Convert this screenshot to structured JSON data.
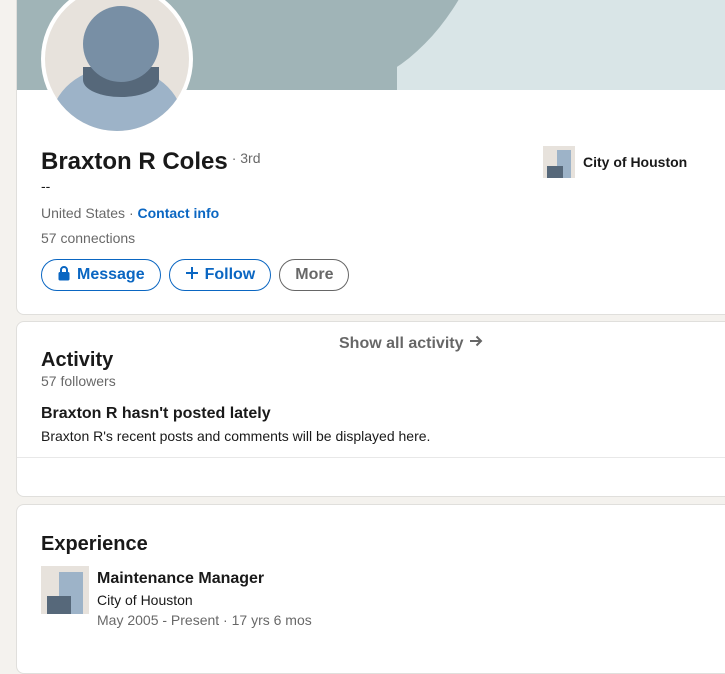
{
  "profile": {
    "name": "Braxton R Coles",
    "degree": "· 3rd",
    "headline": "--",
    "location": "United States",
    "location_separator": " · ",
    "contact_info": "Contact info",
    "connections_count": "57",
    "connections_label": " connections",
    "company": "City of Houston",
    "buttons": {
      "message": "Message",
      "follow": "Follow",
      "more": "More"
    }
  },
  "activity": {
    "title": "Activity",
    "followers": "57 followers",
    "empty_title": "Braxton R hasn't posted lately",
    "empty_desc": "Braxton R's recent posts and comments will be displayed here.",
    "show_all": "Show all activity"
  },
  "experience": {
    "title": "Experience",
    "items": [
      {
        "title": "Maintenance Manager",
        "company": "City of Houston",
        "dates": "May 2005 - Present · 17 yrs 6 mos"
      }
    ]
  },
  "colors": {
    "accent": "#0a66c2",
    "background": "#f4f2ee",
    "banner": "#a0b4b7"
  },
  "icons": {
    "message": "lock-icon",
    "follow": "plus-icon",
    "show_all": "arrow-right-icon"
  }
}
